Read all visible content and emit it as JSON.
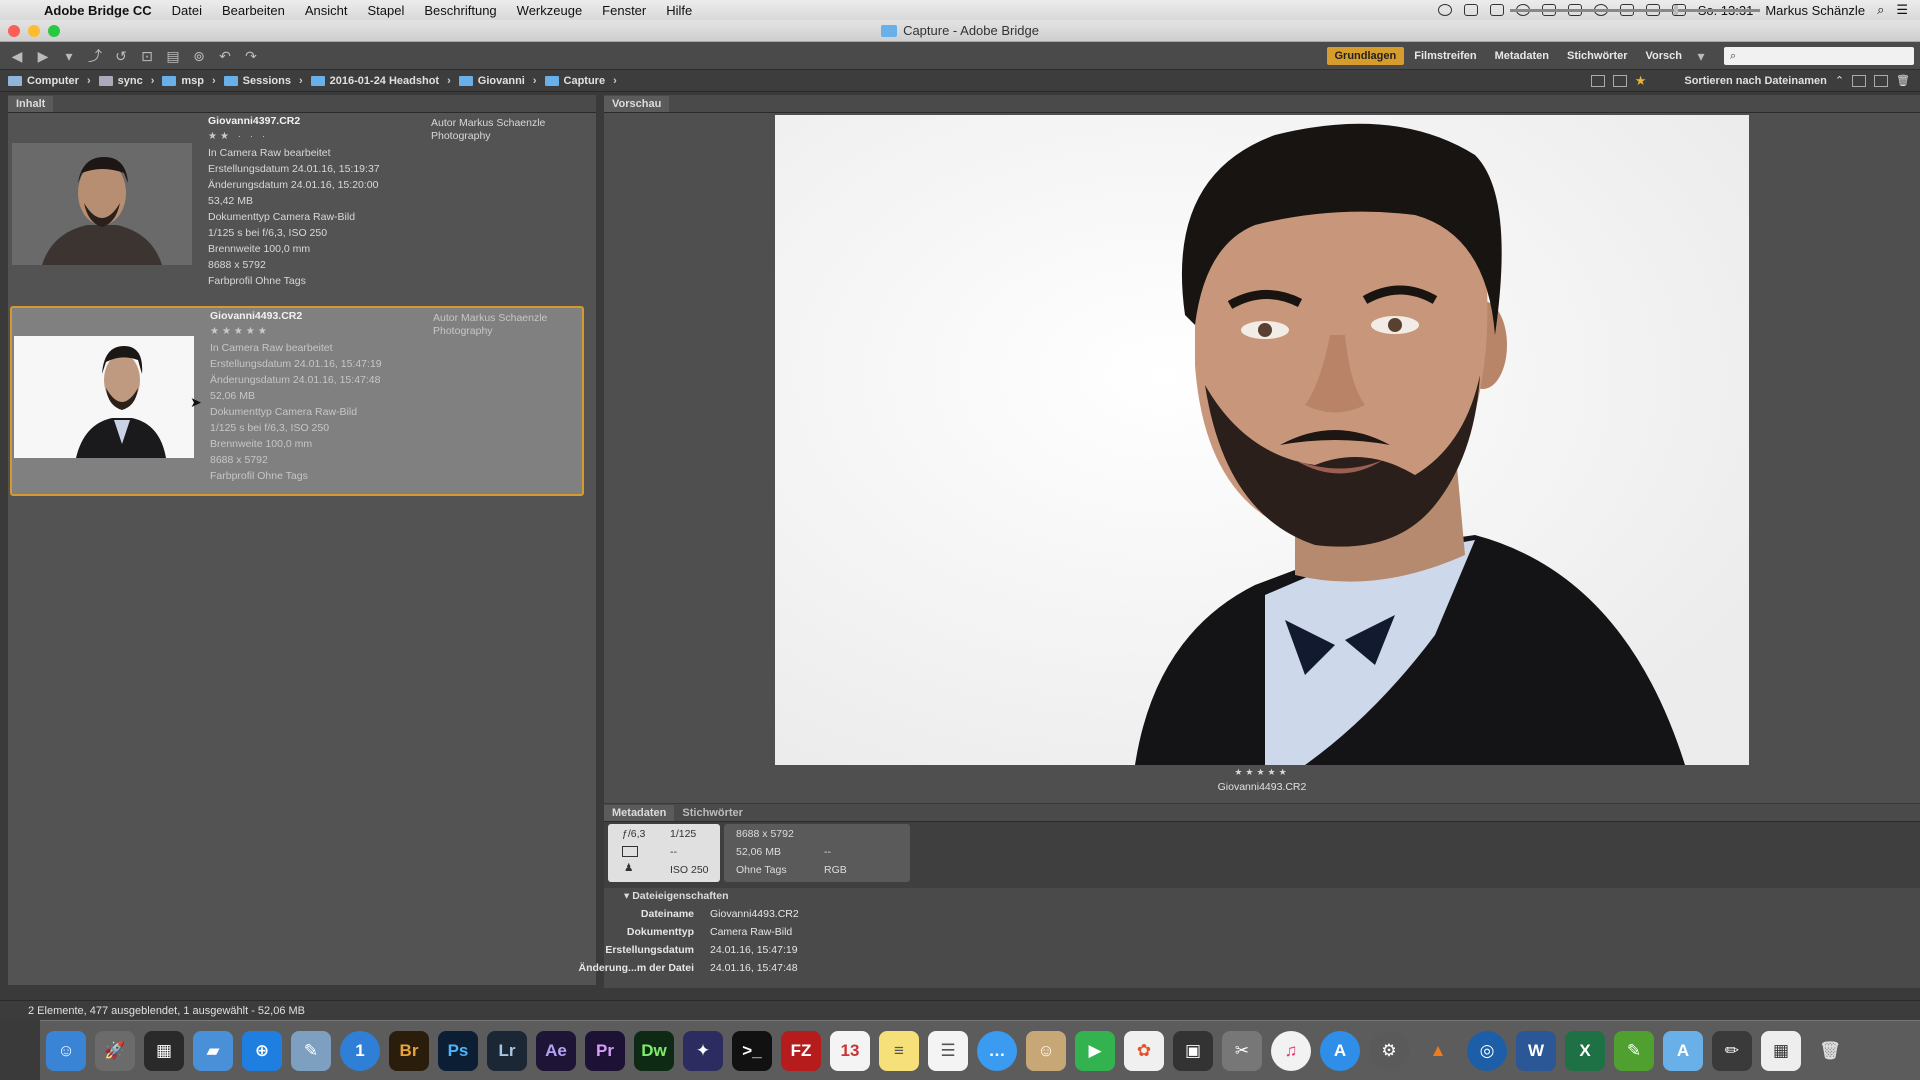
{
  "menubar": {
    "app": "Adobe Bridge CC",
    "items": [
      "Datei",
      "Bearbeiten",
      "Ansicht",
      "Stapel",
      "Beschriftung",
      "Werkzeuge",
      "Fenster",
      "Hilfe"
    ],
    "clock": "So. 13:31",
    "user": "Markus Schänzle"
  },
  "window": {
    "title": "Capture - Adobe Bridge"
  },
  "workspaces": [
    "Grundlagen",
    "Filmstreifen",
    "Metadaten",
    "Stichwörter",
    "Vorsch"
  ],
  "search": {
    "placeholder": ""
  },
  "path": [
    "Computer",
    "sync",
    "msp",
    "Sessions",
    "2016-01-24 Headshot",
    "Giovanni",
    "Capture"
  ],
  "sort": {
    "label": "Sortieren nach Dateinamen"
  },
  "panels": {
    "content": "Inhalt",
    "preview": "Vorschau",
    "metadata": "Metadaten",
    "keywords": "Stichwörter"
  },
  "items": [
    {
      "name": "Giovanni4397.CR2",
      "stars": "★★ · · ·",
      "camera_raw": "In Camera Raw bearbeitet",
      "created": "Erstellungsdatum 24.01.16, 15:19:37",
      "modified": "Änderungsdatum 24.01.16, 15:20:00",
      "size": "53,42 MB",
      "doctype": "Dokumenttyp Camera Raw-Bild",
      "exposure": "1/125 s bei f/6,3, ISO 250",
      "focal": "Brennweite 100,0 mm",
      "dimensions": "8688 x 5792",
      "profile": "Farbprofil Ohne Tags",
      "author": "Autor Markus Schaenzle Photography"
    },
    {
      "name": "Giovanni4493.CR2",
      "stars": "★★★★★",
      "camera_raw": "In Camera Raw bearbeitet",
      "created": "Erstellungsdatum 24.01.16, 15:47:19",
      "modified": "Änderungsdatum 24.01.16, 15:47:48",
      "size": "52,06 MB",
      "doctype": "Dokumenttyp Camera Raw-Bild",
      "exposure": "1/125 s bei f/6,3, ISO 250",
      "focal": "Brennweite 100,0 mm",
      "dimensions": "8688 x 5792",
      "profile": "Farbprofil Ohne Tags",
      "author": "Autor Markus Schaenzle Photography"
    }
  ],
  "preview": {
    "stars": "★★★★★",
    "filename": "Giovanni4493.CR2"
  },
  "camera": {
    "aperture": "ƒ/6,3",
    "shutter": "1/125",
    "metering": "--",
    "iso": "ISO 250"
  },
  "info": {
    "dimensions": "8688 x 5792",
    "size": "52,06 MB",
    "dash": "--",
    "profile": "Ohne Tags",
    "mode": "RGB"
  },
  "fileprops": {
    "section": "Dateieigenschaften",
    "rows": [
      {
        "key": "Dateiname",
        "value": "Giovanni4493.CR2"
      },
      {
        "key": "Dokumenttyp",
        "value": "Camera Raw-Bild"
      },
      {
        "key": "Erstellungsdatum",
        "value": "24.01.16, 15:47:19"
      },
      {
        "key": "Änderung...m der Datei",
        "value": "24.01.16, 15:47:48"
      }
    ]
  },
  "status": {
    "text": "2 Elemente, 477 ausgeblendet, 1 ausgewählt - 52,06 MB"
  },
  "dock": {
    "apps": [
      {
        "label": "Br",
        "bg": "#2b1d0c",
        "fg": "#e8a33b",
        "icon": "bridge-icon"
      },
      {
        "label": "Ps",
        "bg": "#0c1e33",
        "fg": "#4fb4f7",
        "icon": "photoshop-icon"
      },
      {
        "label": "Lr",
        "bg": "#1b2735",
        "fg": "#a9c5df",
        "icon": "lightroom-icon"
      },
      {
        "label": "Ae",
        "bg": "#1e1536",
        "fg": "#b3a3f7",
        "icon": "aftereffects-icon"
      },
      {
        "label": "Pr",
        "bg": "#1d1235",
        "fg": "#d69ef7",
        "icon": "premiere-icon"
      },
      {
        "label": "Dw",
        "bg": "#0f2a14",
        "fg": "#7fea6c",
        "icon": "dreamweaver-icon"
      }
    ]
  }
}
